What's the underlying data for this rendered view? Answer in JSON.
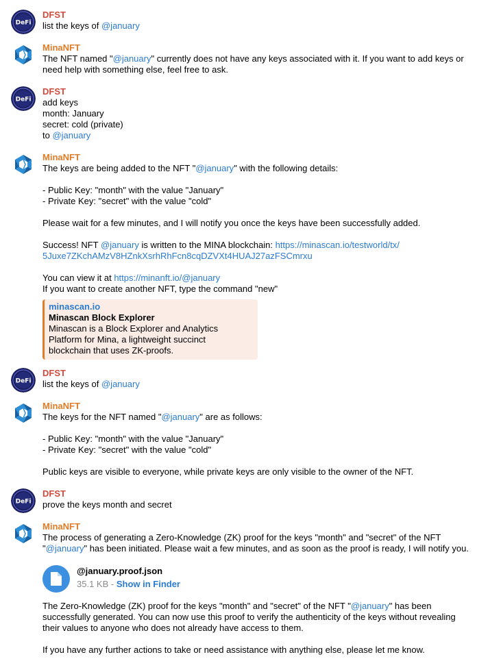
{
  "senders": {
    "dfst": "DFST",
    "mina": "MinaNFT"
  },
  "icons": {
    "dfst_avatar": "defi-logo-avatar",
    "mina_avatar": "minanft-logo-avatar",
    "file": "document-icon"
  },
  "colors": {
    "dfst_name": "#d14b3e",
    "mina_name": "#e07b27",
    "link": "#2a7bd2",
    "preview_bg": "#fbede6",
    "file_icon": "#3d8fe0"
  },
  "messages": {
    "m1": {
      "t1": "list the keys of ",
      "mention": "@january"
    },
    "m2": {
      "t1": "The NFT named \"",
      "mention": "@january",
      "t2": "\" currently does not have any keys associated with it. If you want to add keys or",
      "l2": "need help with something else, feel free to ask."
    },
    "m3": {
      "l1": "add keys",
      "l2": "month: January",
      "l3": "secret: cold (private)",
      "l4_prefix": "to ",
      "mention": "@january"
    },
    "m4": {
      "l1_a": "The keys are being added to the NFT \"",
      "mention": "@january",
      "l1_b": "\" with the following details:",
      "pub": "- Public Key: \"month\" with the value \"January\"",
      "priv": "- Private Key: \"secret\" with the value \"cold\"",
      "wait": "Please wait for a few minutes, and I will notify you once the keys have been successfully added.",
      "success_a": "Success! NFT ",
      "success_mention": "@january",
      "success_b": " is written to the MINA blockchain: ",
      "tx_link_1": "https://minascan.io/testworld/tx/",
      "tx_link_2": "5Juxe7ZKchAMzV8HZnkXsrhRhFcn8cqDZVXt4HUAJ27azFSCmrxu",
      "view_prefix": "You can view it at ",
      "view_link": "https://minanft.io/@january",
      "another": "If you want to create another NFT, type the command \"new\"",
      "preview": {
        "site": "minascan.io",
        "title": "Minascan Block Explorer",
        "desc_1": "Minascan is a Block Explorer and Analytics",
        "desc_2": "Platform for Mina, a lightweight succinct",
        "desc_3": "blockchain that uses ZK-proofs."
      }
    },
    "m5": {
      "t1": "list the keys of ",
      "mention": "@january"
    },
    "m6": {
      "l1_a": "The keys for the NFT named \"",
      "mention": "@january",
      "l1_b": "\" are as follows:",
      "pub": "- Public Key: \"month\" with the value \"January\"",
      "priv": "- Private Key: \"secret\" with the value \"cold\"",
      "note": "Public keys are visible to everyone, while private keys are only visible to the owner of the NFT."
    },
    "m7": {
      "t1": "prove the keys month and secret"
    },
    "m8": {
      "l1": "The process of generating a Zero-Knowledge (ZK) proof for the keys \"month\" and \"secret\" of the NFT",
      "l2_q": "\"",
      "mention": "@january",
      "l2_b": "\" has been initiated. Please wait a few minutes, and as soon as the proof is ready, I will notify you.",
      "file": {
        "name": "@january.proof.json",
        "size": "35.1 KB",
        "sep": " - ",
        "action": "Show in Finder"
      },
      "r1_a": "The Zero-Knowledge (ZK) proof for the keys \"month\" and \"secret\" of the NFT \"",
      "r1_mention": "@january",
      "r1_b": "\" has been",
      "r2": "successfully generated. You can now use this proof to verify the authenticity of the keys without revealing",
      "r3": "their values to anyone who does not already have access to them.",
      "r4": "If you have any further actions to take or need assistance with anything else, please let me know."
    }
  }
}
